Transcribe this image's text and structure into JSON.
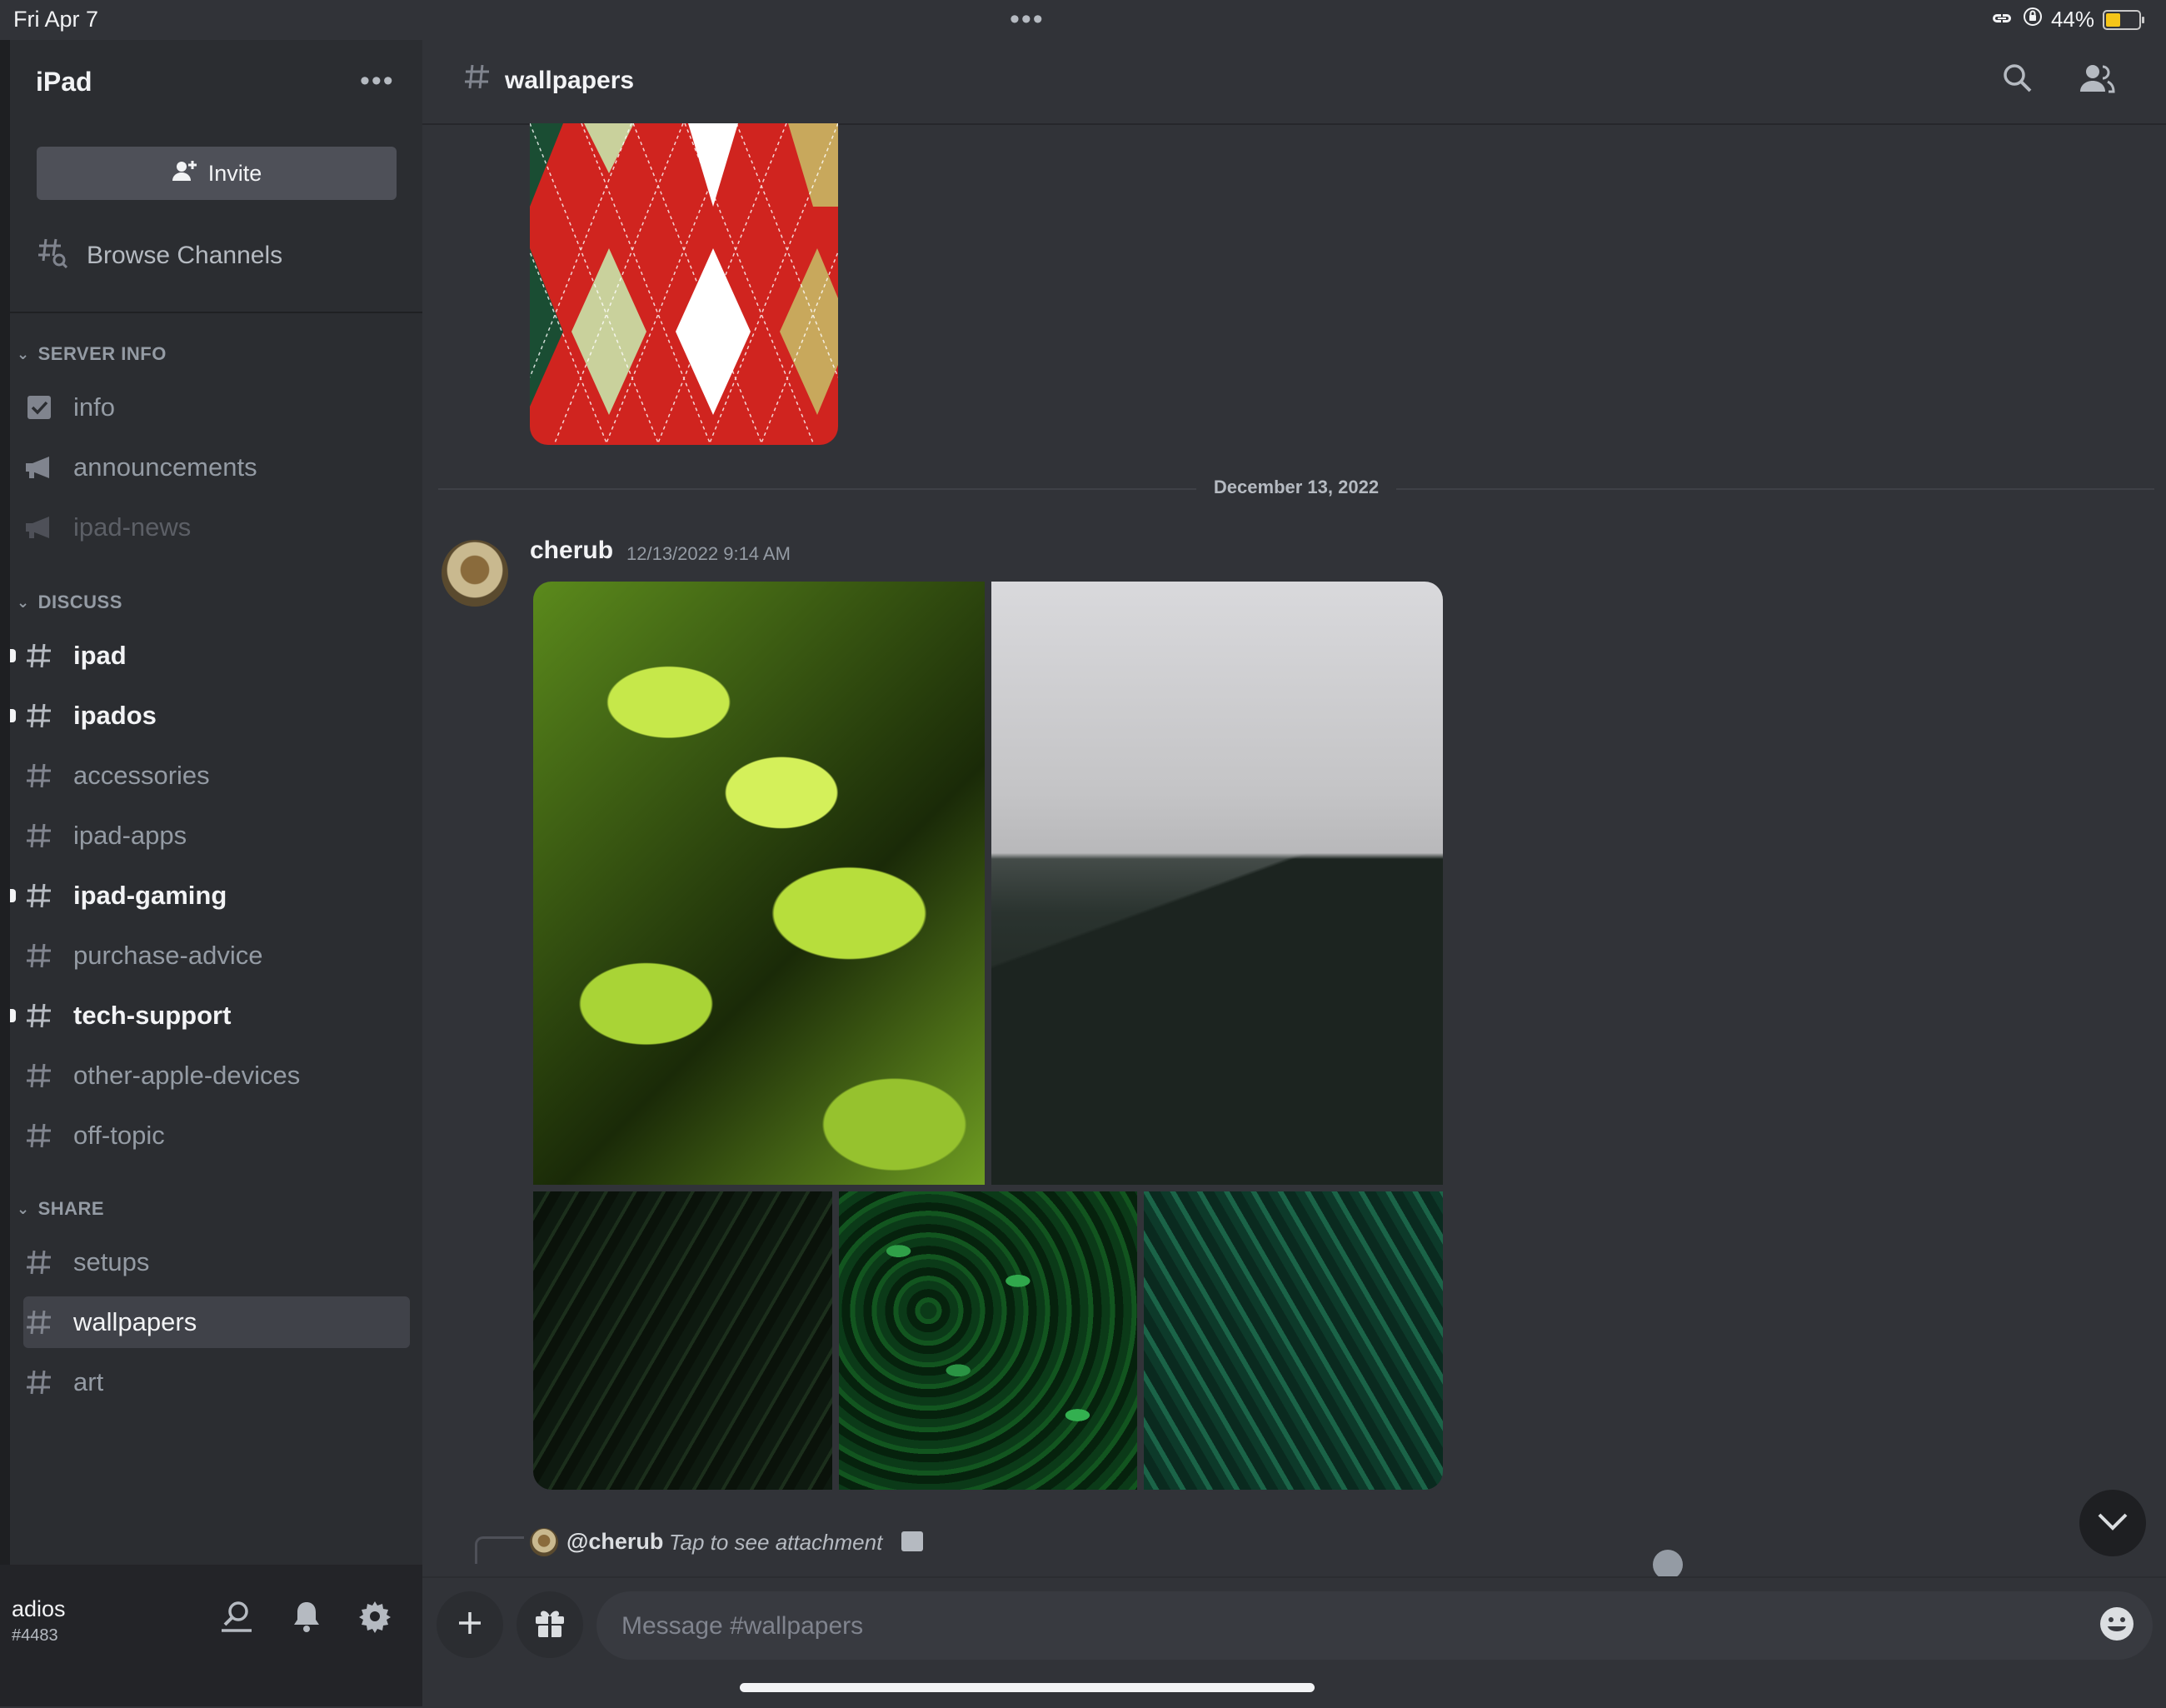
{
  "status_bar": {
    "date": "Fri Apr 7",
    "battery": "44%",
    "battery_level": 0.44
  },
  "server": {
    "name": "iPad",
    "invite_label": "Invite",
    "browse_label": "Browse Channels"
  },
  "categories": [
    {
      "name": "SERVER INFO",
      "channels": [
        {
          "name": "info",
          "icon": "rules-icon",
          "state": "normal"
        },
        {
          "name": "announcements",
          "icon": "megaphone-icon",
          "state": "normal"
        },
        {
          "name": "ipad-news",
          "icon": "megaphone-icon",
          "state": "muted"
        }
      ]
    },
    {
      "name": "DISCUSS",
      "channels": [
        {
          "name": "ipad",
          "icon": "hash-icon",
          "state": "unread"
        },
        {
          "name": "ipados",
          "icon": "hash-icon",
          "state": "unread"
        },
        {
          "name": "accessories",
          "icon": "hash-icon",
          "state": "normal"
        },
        {
          "name": "ipad-apps",
          "icon": "hash-icon",
          "state": "normal"
        },
        {
          "name": "ipad-gaming",
          "icon": "hash-icon",
          "state": "unread"
        },
        {
          "name": "purchase-advice",
          "icon": "hash-icon",
          "state": "normal"
        },
        {
          "name": "tech-support",
          "icon": "hash-icon",
          "state": "unread"
        },
        {
          "name": "other-apple-devices",
          "icon": "hash-icon",
          "state": "normal"
        },
        {
          "name": "off-topic",
          "icon": "hash-icon",
          "state": "normal"
        }
      ]
    },
    {
      "name": "SHARE",
      "channels": [
        {
          "name": "setups",
          "icon": "hash-icon",
          "state": "normal"
        },
        {
          "name": "wallpapers",
          "icon": "hash-icon",
          "state": "active"
        },
        {
          "name": "art",
          "icon": "hash-icon",
          "state": "normal"
        }
      ]
    }
  ],
  "user": {
    "name": "adios",
    "tag": "#4483"
  },
  "header": {
    "channel": "wallpapers"
  },
  "messages": {
    "date_divider": "December 13, 2022",
    "author": "cherub",
    "timestamp": "12/13/2022 9:14 AM",
    "reply_mention": "@cherub",
    "reply_hint": "Tap to see attachment"
  },
  "composer": {
    "placeholder": "Message #wallpapers"
  },
  "colors": {
    "background": "#313338",
    "sidebar": "#2b2d31",
    "active_channel": "#404249"
  }
}
